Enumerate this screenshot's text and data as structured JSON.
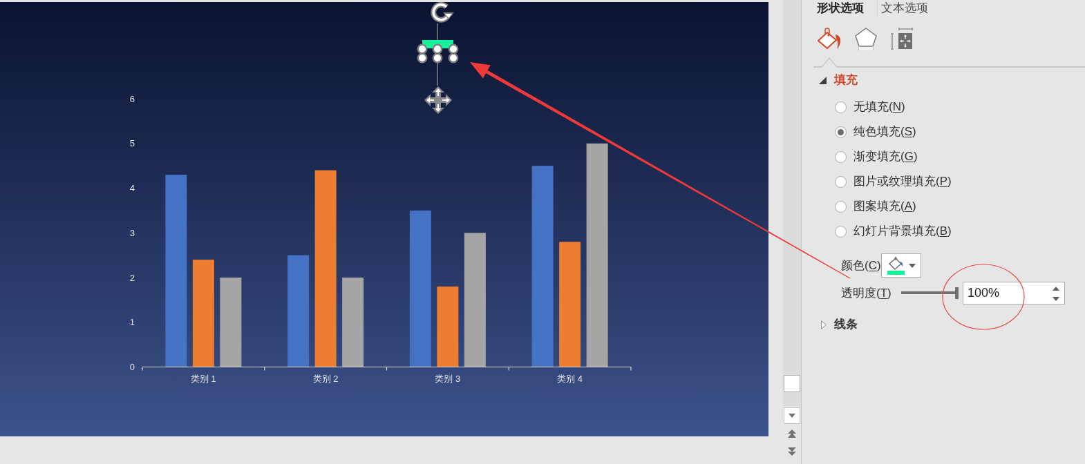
{
  "slide": {
    "chart": {
      "chart_data": {
        "type": "bar",
        "categories": [
          "类别 1",
          "类别 2",
          "类别 3",
          "类别 4"
        ],
        "series": [
          {
            "color": "#4472c4",
            "values": [
              4.3,
              2.5,
              3.5,
              4.5
            ]
          },
          {
            "color": "#ed7d31",
            "values": [
              2.4,
              4.4,
              1.8,
              2.8
            ]
          },
          {
            "color": "#a5a5a5",
            "values": [
              2,
              2,
              3,
              5
            ]
          }
        ],
        "ylim": [
          0,
          6
        ],
        "yticks": [
          0,
          1,
          2,
          3,
          4,
          5,
          6
        ]
      }
    }
  },
  "format_panel": {
    "tabs": [
      {
        "label": "形状选项",
        "selected": true
      },
      {
        "label": "文本选项",
        "selected": false
      }
    ],
    "icon_tabs": [
      {
        "kind": "fill",
        "selected": true
      },
      {
        "kind": "effects",
        "selected": false
      },
      {
        "kind": "size",
        "selected": false
      }
    ],
    "sections": [
      {
        "title": "填充",
        "expanded": true,
        "options": [
          {
            "label": "无填充(N)",
            "selected": false
          },
          {
            "label": "纯色填充(S)",
            "selected": true
          },
          {
            "label": "渐变填充(G)",
            "selected": false
          },
          {
            "label": "图片或纹理填充(P)",
            "selected": false
          },
          {
            "label": "图案填充(A)",
            "selected": false
          },
          {
            "label": "幻灯片背景填充(B)",
            "selected": false
          }
        ],
        "color_picker": {
          "label": "颜色(C)"
        },
        "transparency": {
          "label": "透明度(T)",
          "level": 1,
          "value": "100%"
        }
      },
      {
        "title": "线条",
        "expanded": false
      }
    ]
  }
}
